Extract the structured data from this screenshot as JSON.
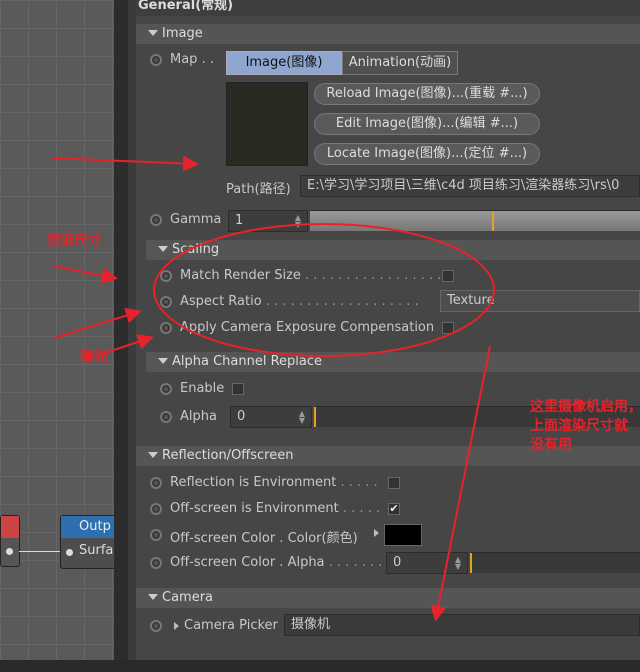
{
  "header": {
    "general": "General(常规)"
  },
  "sections": {
    "image": "Image",
    "scaling": "Scaling",
    "alpha_replace": "Alpha Channel Replace",
    "reflection": "Reflection/Offscreen",
    "camera": "Camera"
  },
  "map": {
    "label": "Map . .",
    "tab_image": "Image(图像)",
    "tab_animation": "Animation(动画)",
    "reload": "Reload Image(图像)...(重载 #...)",
    "edit": "Edit Image(图像)...(编辑 #...)",
    "locate": "Locate Image(图像)...(定位 #...)",
    "path_label": "Path(路径)",
    "path_value": "E:\\学习\\学习项目\\三维\\c4d 项目练习\\渲染器练习\\rs\\0"
  },
  "gamma": {
    "label": "Gamma",
    "value": "1",
    "level": 0.55
  },
  "scaling": {
    "match_render": "Match Render Size",
    "aspect_ratio": "Aspect Ratio",
    "aspect_value": "Texture",
    "apply_camera": "Apply Camera Exposure Compensation"
  },
  "alpha_replace": {
    "enable": "Enable",
    "alpha_label": "Alpha",
    "alpha_value": "0"
  },
  "reflection": {
    "refl_env": "Reflection is Environment",
    "offscreen_env": "Off-screen is Environment",
    "offscreen_color": "Off-screen Color . Color(颜色)",
    "offscreen_alpha": "Off-screen Color . Alpha",
    "offscreen_alpha_value": "0",
    "offscreen_checked": "✔"
  },
  "camera": {
    "picker_label": "Camera Picker",
    "picker_value": "摄像机"
  },
  "node": {
    "output": "Outp",
    "surface": "Surfa"
  },
  "annotations": {
    "render_size": "渲染尺寸",
    "exposure": "曝光",
    "note_line1": "这里摄像机启用，",
    "note_line2": "上面渲染尺寸就",
    "note_line3": "没有用"
  },
  "colors": {
    "accent_tick": "#e8a020",
    "annotation": "#e8222a",
    "selected_tab": "#8fa7d0"
  }
}
